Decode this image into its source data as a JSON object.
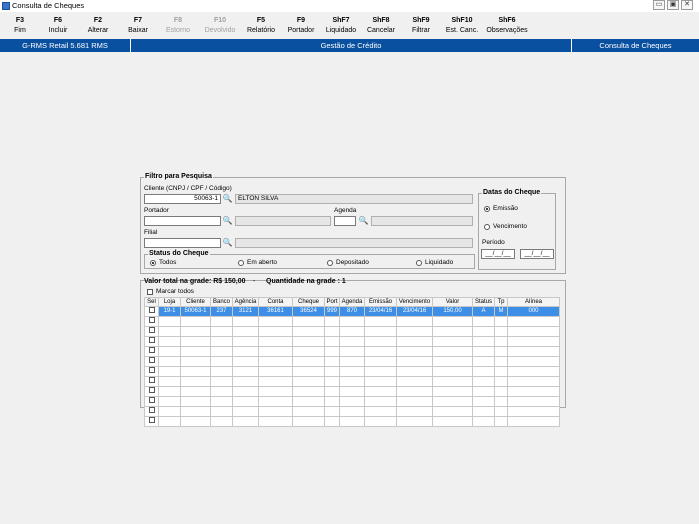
{
  "window": {
    "title": "Consulta de Cheques",
    "minimize": "▭",
    "restore": "▣",
    "close": "✕"
  },
  "toolbar": [
    {
      "key": "F3",
      "label": "Fim",
      "enabled": true
    },
    {
      "key": "F6",
      "label": "Incluir",
      "enabled": true
    },
    {
      "key": "F2",
      "label": "Alterar",
      "enabled": true
    },
    {
      "key": "F7",
      "label": "Baixar",
      "enabled": true
    },
    {
      "key": "F8",
      "label": "Estorno",
      "enabled": false
    },
    {
      "key": "F10",
      "label": "Devolvido",
      "enabled": false
    },
    {
      "key": "F5",
      "label": "Relatório",
      "enabled": true
    },
    {
      "key": "F9",
      "label": "Portador",
      "enabled": true
    },
    {
      "key": "ShF7",
      "label": "Liquidado",
      "enabled": true
    },
    {
      "key": "ShF8",
      "label": "Cancelar",
      "enabled": true
    },
    {
      "key": "ShF9",
      "label": "Filtrar",
      "enabled": true
    },
    {
      "key": "ShF10",
      "label": "Est. Canc.",
      "enabled": true
    },
    {
      "key": "ShF6",
      "label": "Observações",
      "enabled": true
    }
  ],
  "header": {
    "app": "G-RMS Retail 5.681 RMS",
    "module": "Gestão de Crédito",
    "screen": "Consulta de Cheques",
    "color": "#0a50a0"
  },
  "filter": {
    "legend": "Filtro para Pesquisa",
    "cliente_label": "Cliente (CNPJ / CPF / Código)",
    "cliente_value": "50063-1",
    "cliente_name": "ELTON SILVA",
    "portador_label": "Portador",
    "portador_value": "",
    "agenda_label": "Agenda",
    "agenda_value": "",
    "filial_label": "Filial",
    "filial_value": "",
    "status_legend": "Status do Cheque",
    "status_options": [
      "Todos",
      "Em aberto",
      "Depositado",
      "Liquidado"
    ],
    "status_selected": "Todos",
    "datas_legend": "Datas do Cheque",
    "datas_options": [
      "Emissão",
      "Vencimento"
    ],
    "datas_selected": "Emissão",
    "periodo_label": "Período",
    "periodo_from": "__/__/__",
    "periodo_to": "__/__/__"
  },
  "results": {
    "valor_total": "Valor total na grade: R$ 150,00",
    "separator": "-",
    "quantidade": "Quantidade na grade : 1",
    "marcar_todos": "Marcar todos",
    "columns": [
      "Sel",
      "Loja",
      "Cliente",
      "Banco",
      "Agência",
      "Conta",
      "Cheque",
      "Port",
      "Agenda",
      "Emissão",
      "Vencimento",
      "Valor",
      "Status",
      "Tp",
      "Alínea"
    ],
    "rows": [
      [
        "",
        "19-1",
        "50063-1",
        "237",
        "3121",
        "36161",
        "36524",
        "999",
        "870",
        "23/04/16",
        "23/04/16",
        "150,00",
        "A",
        "M",
        "000"
      ]
    ],
    "empty_rows": 11,
    "selection_color": "#3d8ee6"
  }
}
